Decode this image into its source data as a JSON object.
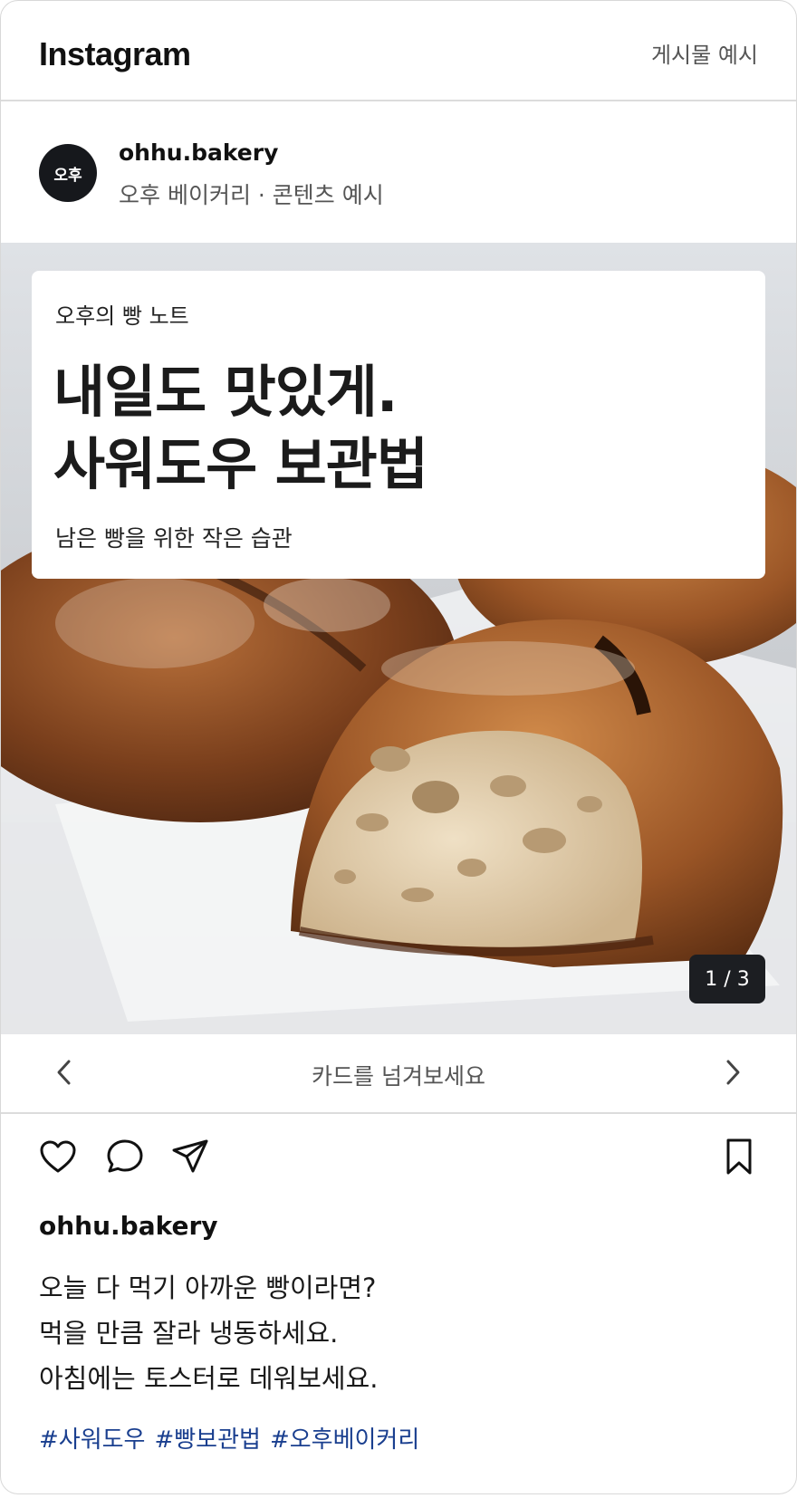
{
  "topbar": {
    "brand": "Instagram",
    "right_label": "게시물 예시"
  },
  "profile": {
    "avatar_text": "오후",
    "username": "ohhu.bakery",
    "subtitle": "오후 베이커리 · 콘텐츠 예시"
  },
  "card": {
    "kicker": "오후의 빵 노트",
    "headline_line1": "내일도 맛있게.",
    "headline_line2": "사워도우 보관법",
    "sub": "남은 빵을 위한 작은 습관"
  },
  "counter": "1 / 3",
  "swipe": {
    "label": "카드를 넘겨보세요",
    "prev_icon": "chevron-left-icon",
    "next_icon": "chevron-right-icon"
  },
  "actions": {
    "like_icon": "heart-icon",
    "comment_icon": "comment-icon",
    "share_icon": "send-icon",
    "save_icon": "bookmark-icon"
  },
  "caption": {
    "username": "ohhu.bakery",
    "lines": [
      "오늘 다 먹기 아까운 빵이라면?",
      "먹을 만큼 잘라 냉동하세요.",
      "아침에는 토스터로 데워보세요."
    ],
    "hashtags": [
      "#사워도우",
      "#빵보관법",
      "#오후베이커리"
    ]
  },
  "colors": {
    "hashtag": "#1a3f8f",
    "counter_bg": "#1c1e22",
    "divider": "#dcdcdc"
  }
}
